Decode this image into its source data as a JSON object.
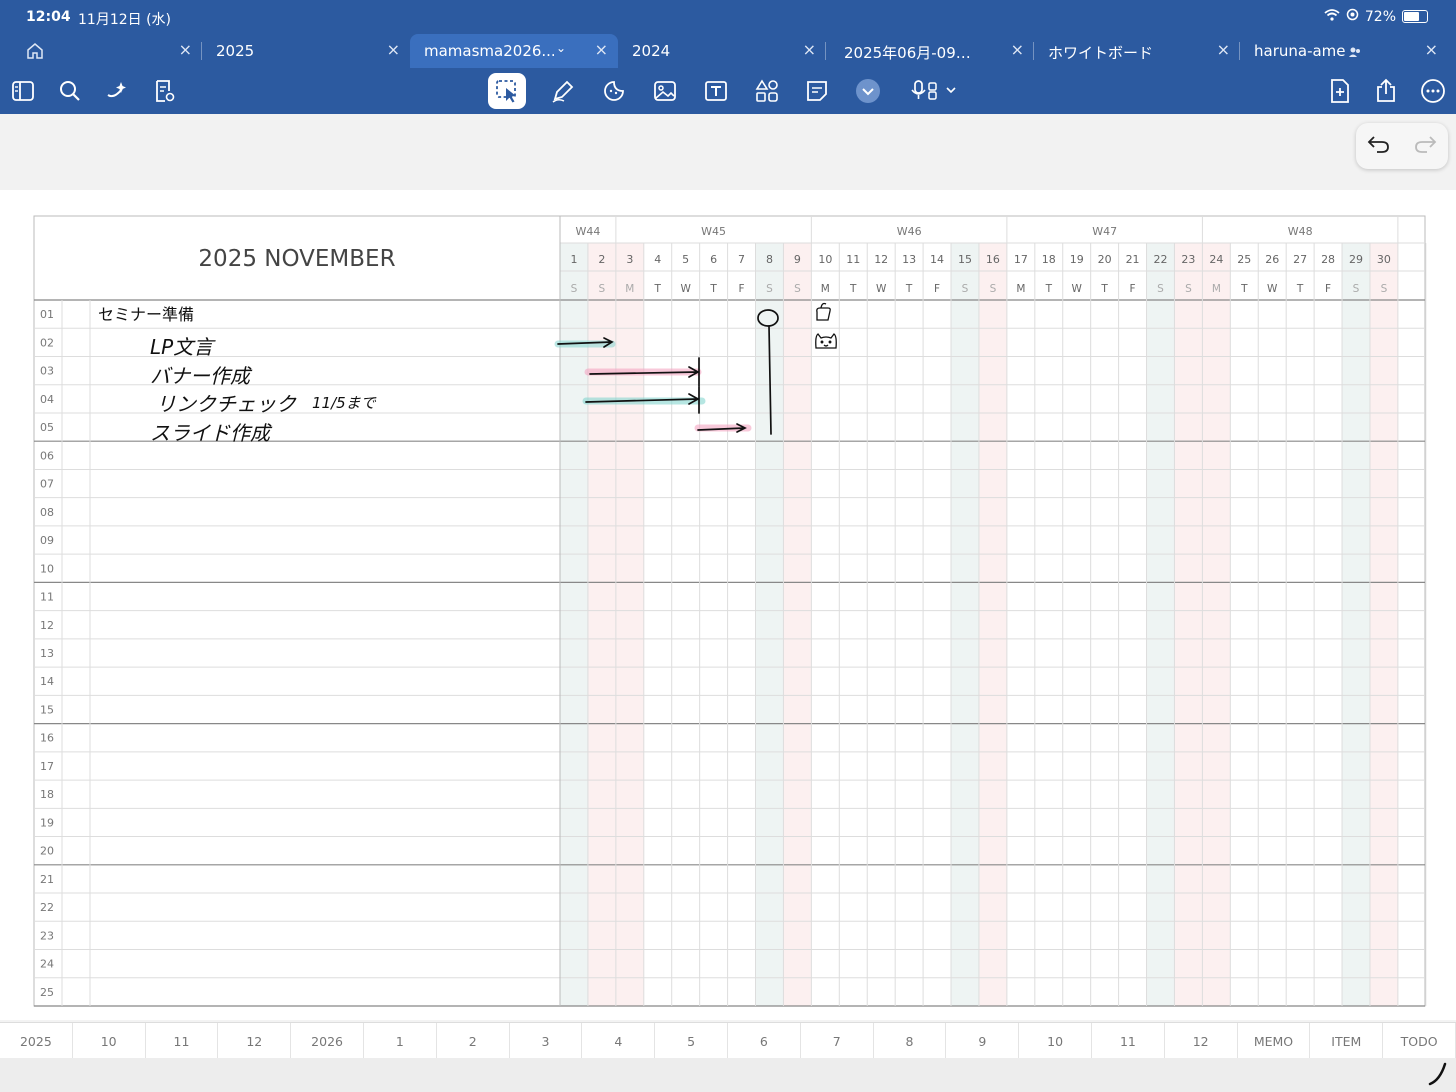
{
  "status": {
    "time": "12:04",
    "date": "11月12日 (水)",
    "battery": "72%",
    "battery_level": 0.72
  },
  "tabs": [
    {
      "label": "",
      "home": true
    },
    {
      "label": "2025"
    },
    {
      "label": "mamasma2026...",
      "active": true
    },
    {
      "label": "2024"
    },
    {
      "label": "2025年06月-09…"
    },
    {
      "label": "ホワイトボード"
    },
    {
      "label": "haruna-ame"
    }
  ],
  "toolbar": {
    "left_icons": [
      "sidebar-icon",
      "search-icon",
      "ai-sparkle-icon",
      "document-settings-icon"
    ],
    "center_icons": [
      "lasso-select-icon",
      "pen-icon",
      "sticker-icon",
      "image-icon",
      "text-box-icon",
      "shapes-icon",
      "sticky-note-icon",
      "more-tools-icon",
      "audio-record-icon"
    ],
    "right_icons": [
      "add-page-icon",
      "share-icon",
      "more-icon"
    ]
  },
  "planner": {
    "title": "2025 NOVEMBER",
    "weeks": [
      {
        "label": "W44",
        "span": 2
      },
      {
        "label": "W45",
        "span": 7
      },
      {
        "label": "W46",
        "span": 7
      },
      {
        "label": "W47",
        "span": 7
      },
      {
        "label": "W48",
        "span": 7
      }
    ],
    "days": [
      "1",
      "2",
      "3",
      "4",
      "5",
      "6",
      "7",
      "8",
      "9",
      "10",
      "11",
      "12",
      "13",
      "14",
      "15",
      "16",
      "17",
      "18",
      "19",
      "20",
      "21",
      "22",
      "23",
      "24",
      "25",
      "26",
      "27",
      "28",
      "29",
      "30"
    ],
    "weekdays": [
      "S",
      "S",
      "M",
      "T",
      "W",
      "T",
      "F",
      "S",
      "S",
      "M",
      "T",
      "W",
      "T",
      "F",
      "S",
      "S",
      "M",
      "T",
      "W",
      "T",
      "F",
      "S",
      "S",
      "M",
      "T",
      "W",
      "T",
      "F",
      "S",
      "S"
    ],
    "day_kinds": [
      "sat",
      "sun",
      "hol",
      "",
      "",
      "",
      "",
      "sat",
      "sun",
      "",
      "",
      "",
      "",
      "",
      "sat",
      "sun",
      "",
      "",
      "",
      "",
      "",
      "sat",
      "sun",
      "hol",
      "",
      "",
      "",
      "",
      "sat",
      "sun"
    ],
    "rows": [
      "01",
      "02",
      "03",
      "04",
      "05",
      "06",
      "07",
      "08",
      "09",
      "10",
      "11",
      "12",
      "13",
      "14",
      "15",
      "16",
      "17",
      "18",
      "19",
      "20",
      "21",
      "22",
      "23",
      "24",
      "25"
    ],
    "task_text": "セミナー準備",
    "handwritten": [
      "LP文言",
      "バナー作成",
      "リンクチェック",
      "11/5まで",
      "スライド作成"
    ]
  },
  "bottom_nav": [
    "2025",
    "10",
    "11",
    "12",
    "2026",
    "1",
    "2",
    "3",
    "4",
    "5",
    "6",
    "7",
    "8",
    "9",
    "10",
    "11",
    "12",
    "MEMO",
    "ITEM",
    "TODO"
  ],
  "colors": {
    "brand": "#2c5aa0",
    "saturday": "#eef4f3",
    "sunday": "#fcf0f0",
    "pink_marker": "#f4a6c3",
    "teal_marker": "#86d6d0"
  }
}
